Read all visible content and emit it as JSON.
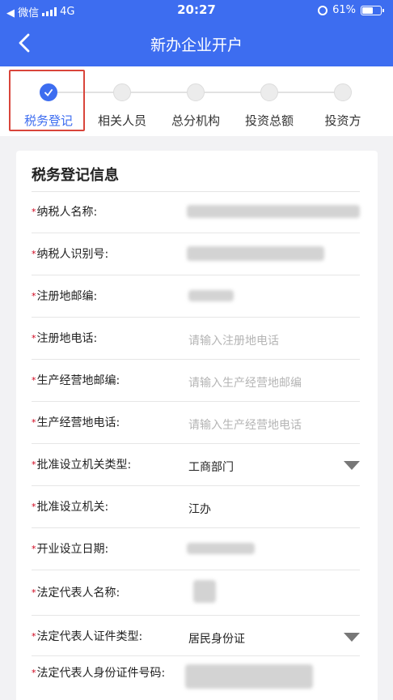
{
  "status_bar": {
    "back_to_app": "◀ 微信",
    "network": "4G",
    "time": "20:27",
    "battery": "61%",
    "battery_level": 0.61
  },
  "nav": {
    "title": "新办企业开户"
  },
  "steps": [
    {
      "label": "税务登记",
      "active": true
    },
    {
      "label": "相关人员",
      "active": false
    },
    {
      "label": "总分机构",
      "active": false
    },
    {
      "label": "投资总额",
      "active": false
    },
    {
      "label": "投资方",
      "active": false
    }
  ],
  "form": {
    "title": "税务登记信息",
    "required_mark": "*",
    "fields": [
      {
        "label": "纳税人名称:",
        "value": "",
        "placeholder": ""
      },
      {
        "label": "纳税人识别号:",
        "value": "",
        "placeholder": ""
      },
      {
        "label": "注册地邮编:",
        "value": "",
        "placeholder": ""
      },
      {
        "label": "注册地电话:",
        "value": "",
        "placeholder": "请输入注册地电话"
      },
      {
        "label": "生产经营地邮编:",
        "value": "",
        "placeholder": "请输入生产经营地邮编"
      },
      {
        "label": "生产经营地电话:",
        "value": "",
        "placeholder": "请输入生产经营地电话"
      },
      {
        "label": "批准设立机关类型:",
        "value": "工商部门",
        "placeholder": "",
        "dropdown": true
      },
      {
        "label": "批准设立机关:",
        "value": "江办",
        "placeholder": ""
      },
      {
        "label": "开业设立日期:",
        "value": "",
        "placeholder": ""
      },
      {
        "label": "法定代表人名称:",
        "value": "",
        "placeholder": ""
      },
      {
        "label": "法定代表人证件类型:",
        "value": "居民身份证",
        "placeholder": "",
        "dropdown": true
      },
      {
        "label": "法定代表人身份证件号码:",
        "value": "",
        "placeholder": ""
      }
    ]
  }
}
